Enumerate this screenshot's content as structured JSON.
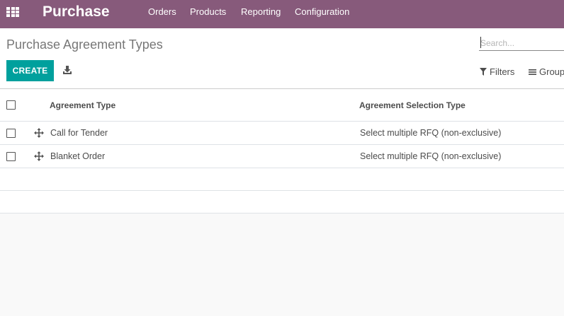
{
  "navbar": {
    "apps_icon": "grid-icon",
    "brand": "Purchase",
    "menu": [
      {
        "label": "Orders"
      },
      {
        "label": "Products"
      },
      {
        "label": "Reporting"
      },
      {
        "label": "Configuration"
      }
    ],
    "color": "#875a7b"
  },
  "control_panel": {
    "title": "Purchase Agreement Types",
    "search": {
      "placeholder": "Search...",
      "value": ""
    },
    "create_label": "CREATE",
    "create_color": "#00a09d",
    "download_icon": "download-icon",
    "filters_label": "Filters",
    "groupby_label": "Group By",
    "filter_icon": "funnel-icon",
    "groupby_icon": "list-icon"
  },
  "table": {
    "columns": [
      "Agreement Type",
      "Agreement Selection Type"
    ],
    "rows": [
      {
        "type": "Call for Tender",
        "selection": "Select multiple RFQ (non-exclusive)"
      },
      {
        "type": "Blanket Order",
        "selection": "Select multiple RFQ (non-exclusive)"
      }
    ]
  }
}
